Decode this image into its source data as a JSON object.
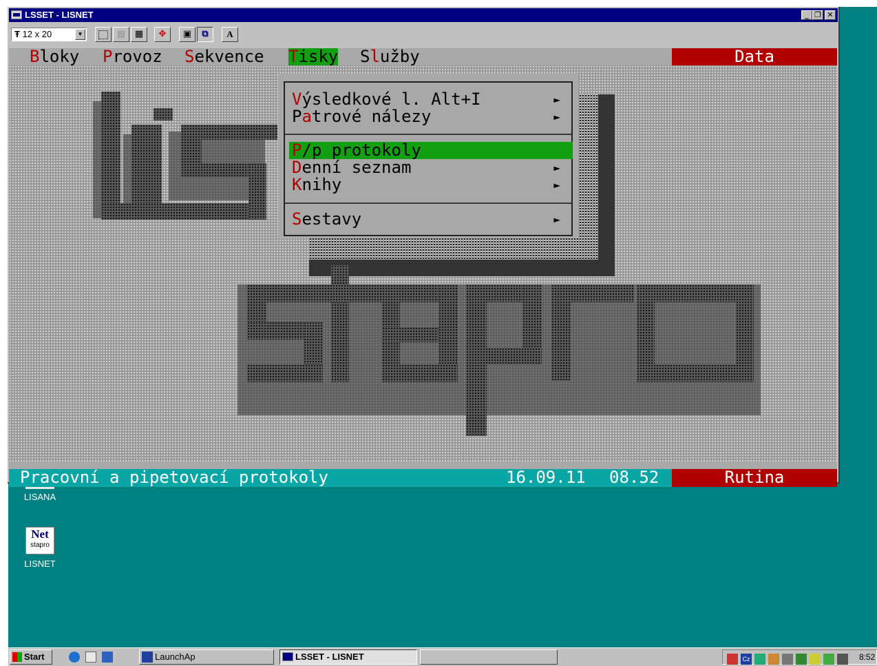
{
  "window": {
    "title": "LSSET - LISNET",
    "font_size": "12 x 20",
    "buttons": {
      "minimize": "_",
      "restore": "❐",
      "close": "✕"
    }
  },
  "menubar": {
    "items": [
      {
        "hotkey": "B",
        "rest": "loky"
      },
      {
        "hotkey": "P",
        "rest": "rovoz"
      },
      {
        "hotkey": "S",
        "rest": "ekvence"
      },
      {
        "hotkey": "T",
        "rest": "isky"
      },
      {
        "hotkey": "S",
        "rest": "lužby"
      }
    ],
    "badge": "Data"
  },
  "dropdown": {
    "items": [
      {
        "hotkey": "V",
        "rest": "ýsledkové l. Alt+I",
        "submenu": true
      },
      {
        "pre": "P",
        "hotkey": "a",
        "rest": "trové nálezy",
        "submenu": true
      },
      {
        "hotkey": "P",
        "rest": "/p protokoly",
        "submenu": false,
        "selected": true
      },
      {
        "hotkey": "D",
        "rest": "enní seznam",
        "submenu": true
      },
      {
        "hotkey": "K",
        "rest": "nihy",
        "submenu": true
      },
      {
        "hotkey": "S",
        "rest": "estavy",
        "submenu": true
      }
    ],
    "arrow": "►"
  },
  "status": {
    "text": "Pracovní a pipetovací protokoly",
    "date": "16.09.11",
    "time": "08.52",
    "mode": "Rutina"
  },
  "desktop_icons": [
    {
      "label": "LISANA"
    },
    {
      "label": "LISNET",
      "glyph": "Net",
      "sub": "stapro"
    }
  ],
  "taskbar": {
    "start": "Start",
    "tasks": [
      "LaunchAp",
      "LSSET - LISNET"
    ],
    "clock": "8:52"
  },
  "colors": {
    "desktop": "#008080",
    "titlebar": "#000080",
    "menu_active": "#12a012",
    "badge": "#b00000",
    "status": "#0aa6a6"
  }
}
